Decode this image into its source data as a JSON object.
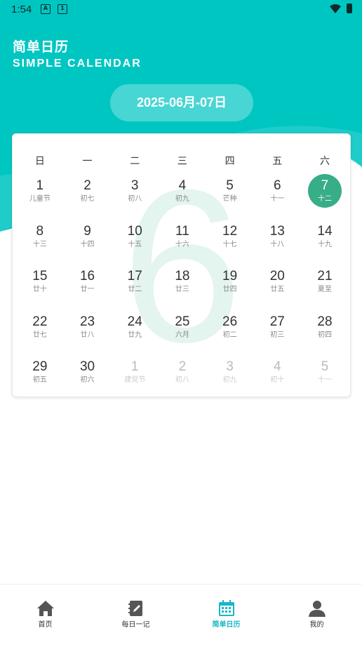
{
  "status_bar": {
    "time": "1:54"
  },
  "header": {
    "title": "简单日历",
    "subtitle": "SIMPLE CALENDAR",
    "date_range": "2025-06月-07日"
  },
  "calendar": {
    "month_watermark": "6",
    "weekdays": [
      "日",
      "一",
      "二",
      "三",
      "四",
      "五",
      "六"
    ],
    "days": [
      {
        "day": "1",
        "lunar": "儿童节",
        "other": false,
        "selected": false
      },
      {
        "day": "2",
        "lunar": "初七",
        "other": false,
        "selected": false
      },
      {
        "day": "3",
        "lunar": "初八",
        "other": false,
        "selected": false
      },
      {
        "day": "4",
        "lunar": "初九",
        "other": false,
        "selected": false
      },
      {
        "day": "5",
        "lunar": "芒种",
        "other": false,
        "selected": false
      },
      {
        "day": "6",
        "lunar": "十一",
        "other": false,
        "selected": false
      },
      {
        "day": "7",
        "lunar": "十二",
        "other": false,
        "selected": true
      },
      {
        "day": "8",
        "lunar": "十三",
        "other": false,
        "selected": false
      },
      {
        "day": "9",
        "lunar": "十四",
        "other": false,
        "selected": false
      },
      {
        "day": "10",
        "lunar": "十五",
        "other": false,
        "selected": false
      },
      {
        "day": "11",
        "lunar": "十六",
        "other": false,
        "selected": false
      },
      {
        "day": "12",
        "lunar": "十七",
        "other": false,
        "selected": false
      },
      {
        "day": "13",
        "lunar": "十八",
        "other": false,
        "selected": false
      },
      {
        "day": "14",
        "lunar": "十九",
        "other": false,
        "selected": false
      },
      {
        "day": "15",
        "lunar": "廿十",
        "other": false,
        "selected": false
      },
      {
        "day": "16",
        "lunar": "廿一",
        "other": false,
        "selected": false
      },
      {
        "day": "17",
        "lunar": "廿二",
        "other": false,
        "selected": false
      },
      {
        "day": "18",
        "lunar": "廿三",
        "other": false,
        "selected": false
      },
      {
        "day": "19",
        "lunar": "廿四",
        "other": false,
        "selected": false
      },
      {
        "day": "20",
        "lunar": "廿五",
        "other": false,
        "selected": false
      },
      {
        "day": "21",
        "lunar": "夏至",
        "other": false,
        "selected": false
      },
      {
        "day": "22",
        "lunar": "廿七",
        "other": false,
        "selected": false
      },
      {
        "day": "23",
        "lunar": "廿八",
        "other": false,
        "selected": false
      },
      {
        "day": "24",
        "lunar": "廿九",
        "other": false,
        "selected": false
      },
      {
        "day": "25",
        "lunar": "六月",
        "other": false,
        "selected": false
      },
      {
        "day": "26",
        "lunar": "初二",
        "other": false,
        "selected": false
      },
      {
        "day": "27",
        "lunar": "初三",
        "other": false,
        "selected": false
      },
      {
        "day": "28",
        "lunar": "初四",
        "other": false,
        "selected": false
      },
      {
        "day": "29",
        "lunar": "初五",
        "other": false,
        "selected": false
      },
      {
        "day": "30",
        "lunar": "初六",
        "other": false,
        "selected": false
      },
      {
        "day": "1",
        "lunar": "建党节",
        "other": true,
        "selected": false
      },
      {
        "day": "2",
        "lunar": "初八",
        "other": true,
        "selected": false
      },
      {
        "day": "3",
        "lunar": "初九",
        "other": true,
        "selected": false
      },
      {
        "day": "4",
        "lunar": "初十",
        "other": true,
        "selected": false
      },
      {
        "day": "5",
        "lunar": "十一",
        "other": true,
        "selected": false
      }
    ]
  },
  "bottom_nav": [
    {
      "label": "首页",
      "icon": "home-icon",
      "active": false
    },
    {
      "label": "每日一记",
      "icon": "notebook-icon",
      "active": false
    },
    {
      "label": "简单日历",
      "icon": "calendar-icon",
      "active": true
    },
    {
      "label": "我的",
      "icon": "user-icon",
      "active": false
    }
  ],
  "colors": {
    "header": "#00c6c2",
    "selected_day": "#37ad88",
    "nav_active": "#17b7c5",
    "nav_inactive": "#555555"
  }
}
